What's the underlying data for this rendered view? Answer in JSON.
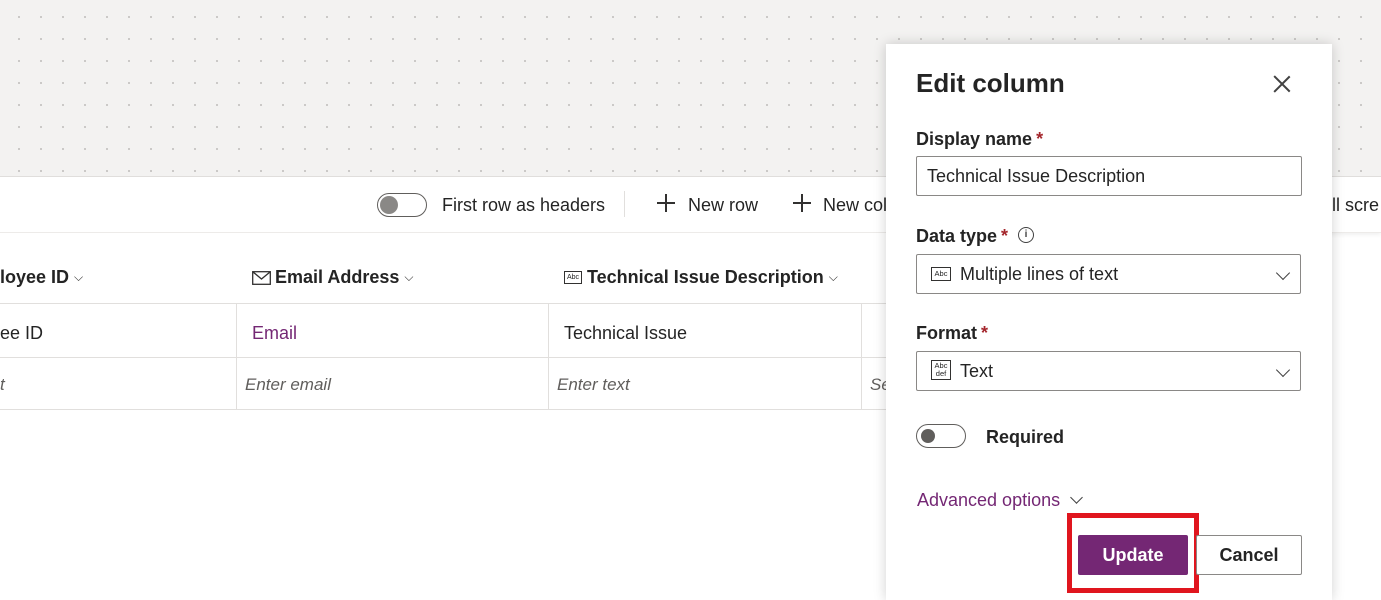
{
  "toolbar": {
    "first_row_label": "First row as headers",
    "new_row_label": "New row",
    "new_column_label": "New col",
    "full_screen_label": "ull scre"
  },
  "grid": {
    "headers": [
      {
        "label": "loyee ID",
        "icon": "none"
      },
      {
        "label": "Email Address",
        "icon": "mail-icon"
      },
      {
        "label": "Technical Issue Description",
        "icon": "text-icon"
      }
    ],
    "text_icon_label": "Abc",
    "row1": [
      "ee ID",
      "Email",
      "Technical Issue"
    ],
    "row2": [
      "t",
      "Enter email",
      "Enter text",
      "Se"
    ]
  },
  "panel": {
    "title": "Edit column",
    "display_name_label": "Display name",
    "display_name_value": "Technical Issue Description",
    "data_type_label": "Data type",
    "data_type_value": "Multiple lines of text",
    "data_type_icon_label": "Abc",
    "format_label": "Format",
    "format_value": "Text",
    "format_icon_label": "Abc def",
    "required_asterisk": "*",
    "required_label": "Required",
    "required_on": false,
    "advanced_options_label": "Advanced options",
    "update_label": "Update",
    "cancel_label": "Cancel",
    "info_glyph": "i"
  },
  "colors": {
    "accent": "#742774",
    "highlight": "#e0151e",
    "required_star": "#a4262c"
  }
}
